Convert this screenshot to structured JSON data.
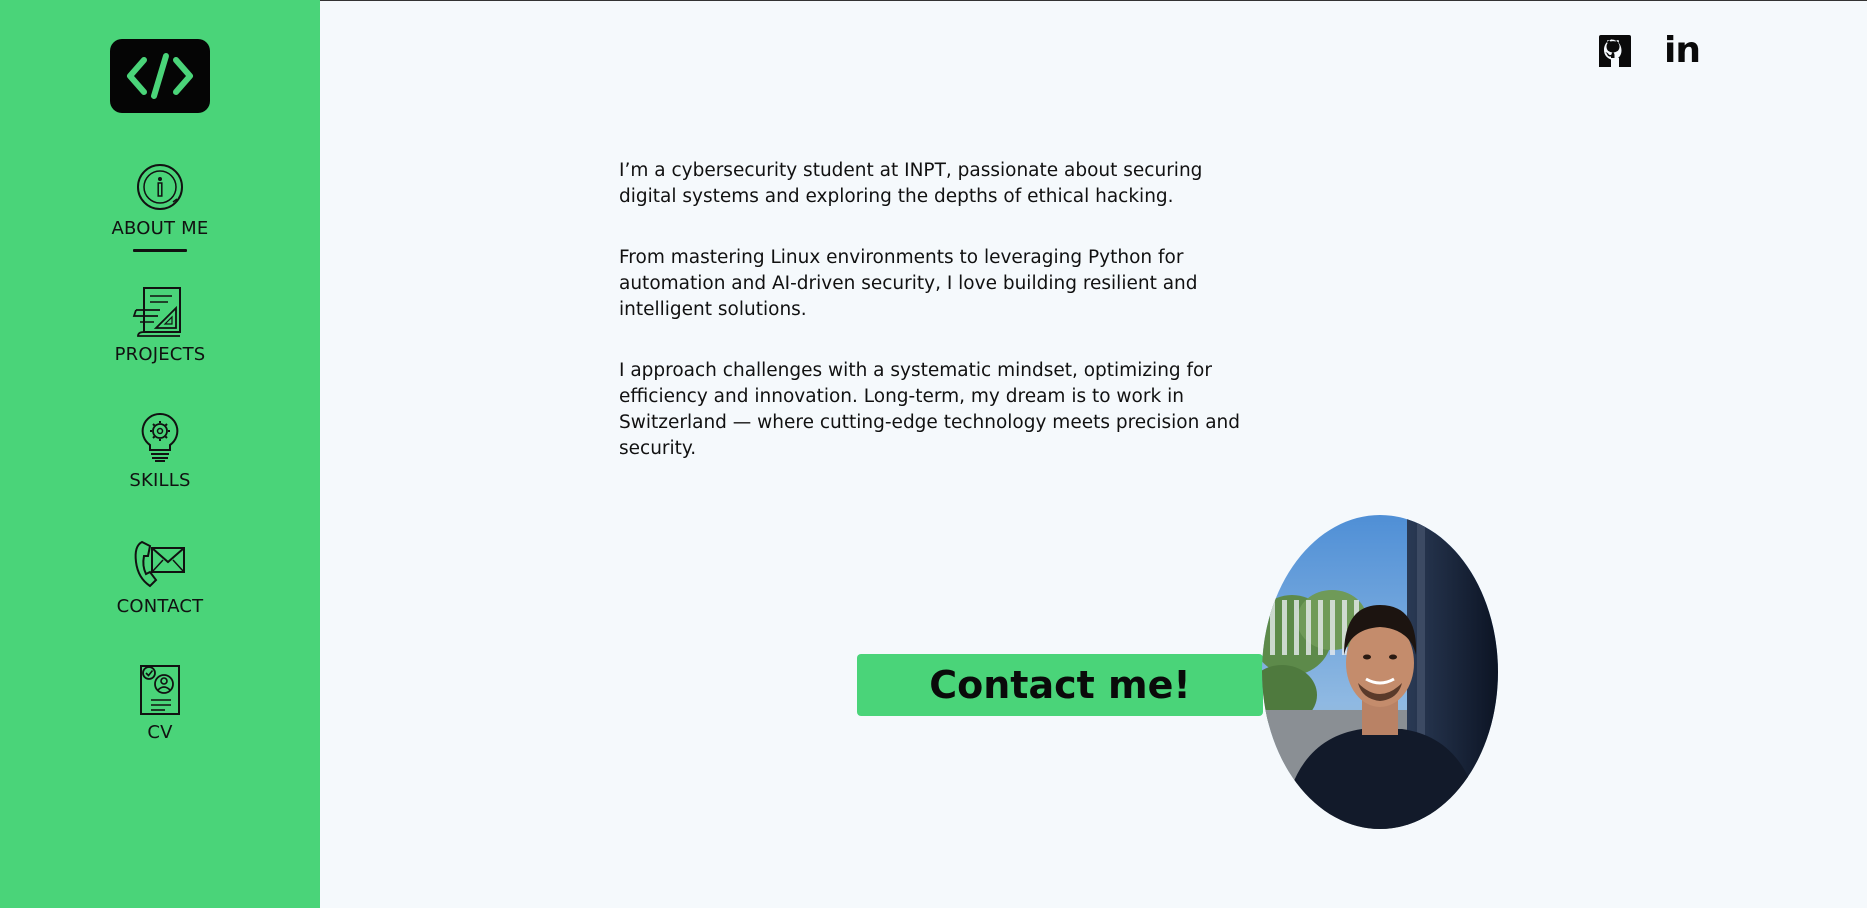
{
  "sidebar": {
    "logo_icon": "code-brackets-icon",
    "items": [
      {
        "label": "ABOUT ME",
        "icon": "info-icon",
        "active": true
      },
      {
        "label": "PROJECTS",
        "icon": "blueprint-icon",
        "active": false
      },
      {
        "label": "SKILLS",
        "icon": "lightbulb-gear-icon",
        "active": false
      },
      {
        "label": "CONTACT",
        "icon": "phone-mail-icon",
        "active": false
      },
      {
        "label": "CV",
        "icon": "resume-icon",
        "active": false
      }
    ]
  },
  "header": {
    "social": [
      {
        "name": "github-icon"
      },
      {
        "name": "linkedin-icon",
        "text": "in"
      }
    ]
  },
  "about": {
    "paragraphs": [
      "I’m a cybersecurity student at INPT, passionate about securing digital systems and exploring the depths of ethical hacking.",
      "From mastering Linux environments to leveraging Python for automation and AI-driven security, I love building resilient and intelligent solutions.",
      "I approach challenges with a systematic mindset, optimizing for efficiency and innovation. Long-term, my dream is to work in Switzerland — where cutting-edge technology meets precision and security."
    ]
  },
  "cta": {
    "label": "Contact me!"
  },
  "colors": {
    "accent": "#4ad479",
    "background": "#f5f9fc",
    "text": "#111111"
  }
}
